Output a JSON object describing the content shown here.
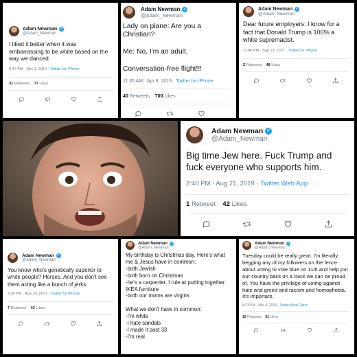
{
  "user": {
    "name": "Adam Newman",
    "handle": "@Adam_Newman"
  },
  "colors": {
    "verified": "#1da1f2",
    "link": "#1b95e0",
    "muted": "#657786"
  },
  "tweets": [
    {
      "text": "I liked it better when it was embarrassing to be white based on the way we danced.",
      "time": "6:47 PM · Dec 3, 2014",
      "client": "Twitter for iPhone",
      "retweets": "31",
      "retweets_label": "Retweets",
      "likes": "77",
      "likes_label": "Likes"
    },
    {
      "text": "Lady on plane: Are you a Christian?\n\nMe: No, I'm an adult.\n\nConversation-free flight!!!",
      "time": "11:35 AM · Apr 8, 2019",
      "client": "Twitter for iPhone",
      "retweets": "40",
      "retweets_label": "Retweets",
      "likes": "700",
      "likes_label": "Likes"
    },
    {
      "text": "Dear future employers: I know for a fact that Donald Trump is 100% a white supremacist.",
      "time": "11:46 PM · Sep 13, 2017",
      "client": "Twitter for iPhone",
      "retweets": "2",
      "retweets_label": "Retweets",
      "likes": "48",
      "likes_label": "Likes"
    },
    {
      "text": "Big time Jew here. Fuck Trump and fuck everyone who supports him.",
      "time": "2:40 PM · Aug 21, 2019",
      "client": "Twitter Web App",
      "retweets": "1",
      "retweets_label": "Retweet",
      "likes": "42",
      "likes_label": "Likes"
    },
    {
      "text": "You know who's genetically superior to white people? Horses. And you don't see them acting like a bunch of jerks.",
      "time": "2:09 PM · Aug 14, 2017",
      "client": "Twitter for iPhone",
      "retweets": "7",
      "retweets_label": "Retweets",
      "likes": "43",
      "likes_label": "Likes"
    },
    {
      "text": "My birthday is Christmas day. Here's what me & Jesus have in common:\n-both Jewish\n-both born on Christmas\n-he's a carpenter, I rule at putting together IKEA furniture\n-both our moms are virgins\n\nWhat we don't have in common:\n-I'm white\n-I hate sandals\n-I made it past 33\n-I'm real"
    },
    {
      "text": "Tuesday could be really great. I'm literally begging any of my followers on the fence about voting to vote blue on 11/6 and help put our country back on a track we can be proud of. You have the privilege of voting against hate and greed and racism and homophobia. It's important.",
      "time": "8:23 PM · Nov 4, 2018",
      "client": "Twitter Web Client",
      "retweets": "10",
      "retweets_label": "Retweets",
      "likes": "61",
      "likes_label": "Likes"
    }
  ]
}
